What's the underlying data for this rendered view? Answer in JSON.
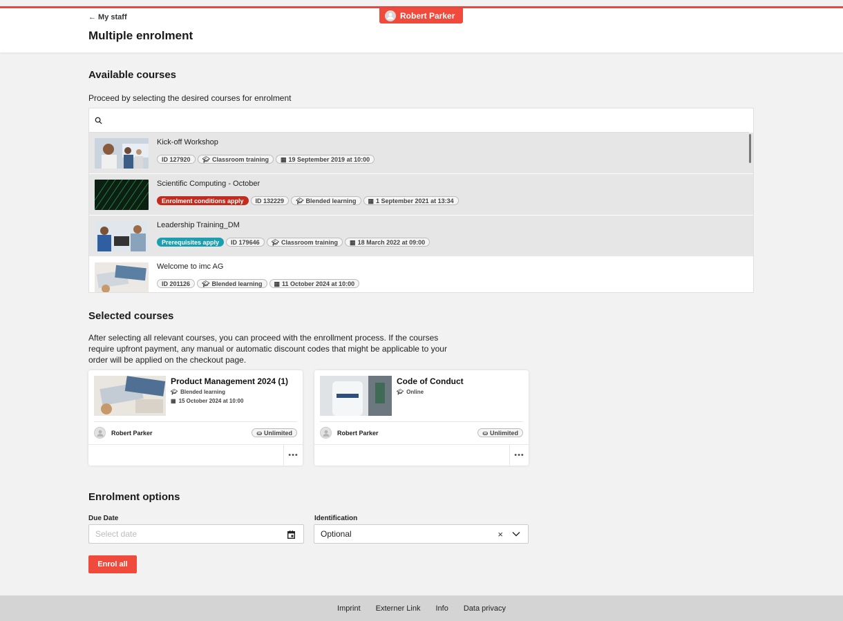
{
  "header": {
    "back_link": "← My staff",
    "title": "Multiple enrolment",
    "user_name": "Robert Parker"
  },
  "available": {
    "title": "Available courses",
    "description": "Proceed by selecting the desired courses for enrolment",
    "search_placeholder": "",
    "courses": [
      {
        "name": "Kick-off Workshop",
        "status": "",
        "id": "ID 127920",
        "type": "Classroom training",
        "date": "19 September 2019 at 10:00",
        "selected": true
      },
      {
        "name": "Scientific Computing - October",
        "status": "Enrolment conditions apply",
        "id": "ID 132229",
        "type": "Blended learning",
        "date": "1 September 2021 at 13:34",
        "selected": true
      },
      {
        "name": "Leadership Training_DM",
        "status": "Prerequisites apply",
        "id": "ID 179646",
        "type": "Classroom training",
        "date": "18 March 2022 at 09:00",
        "selected": true
      },
      {
        "name": "Welcome to imc AG",
        "status": "",
        "id": "ID 201126",
        "type": "Blended learning",
        "date": "11 October 2024 at 10:00",
        "selected": false
      }
    ]
  },
  "selected": {
    "title": "Selected courses",
    "description": "After selecting all relevant courses, you can proceed with the enrollment process. If the courses require upfront payment, any manual or automatic discount codes that might be applicable to your order will be applied on the checkout page.",
    "cards": [
      {
        "title": "Product Management 2024 (1)",
        "type": "Blended learning",
        "date": "15 October 2024 at 10:00",
        "person": "Robert Parker",
        "seats": "Unlimited"
      },
      {
        "title": "Code of Conduct",
        "type": "Online",
        "person": "Robert Parker",
        "seats": "Unlimited"
      }
    ]
  },
  "options": {
    "title": "Enrolment options",
    "due_date_label": "Due Date",
    "due_date_placeholder": "Select date",
    "identification_label": "Identification",
    "identification_value": "Optional",
    "clear_symbol": "×",
    "enrol_button": "Enrol all"
  },
  "footer": {
    "links": [
      "Imprint",
      "Externer Link",
      "Info",
      "Data privacy"
    ]
  },
  "colors": {
    "accent": "#ef4a3c",
    "enrolment_conditions": "#c22c1e",
    "prerequisites": "#1a9eb0"
  }
}
